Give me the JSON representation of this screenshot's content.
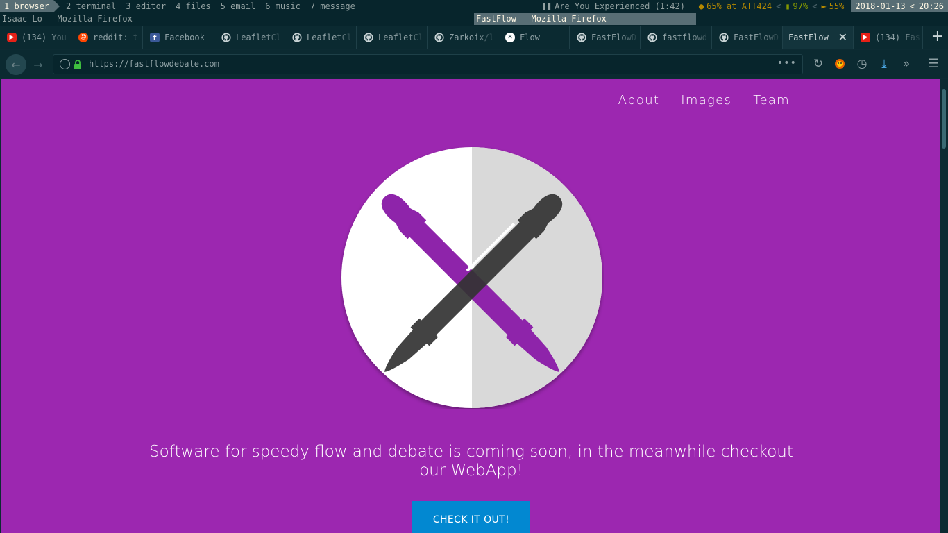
{
  "topbar": {
    "workspaces": [
      {
        "label": "1 browser",
        "active": true
      },
      {
        "label": "2 terminal",
        "active": false
      },
      {
        "label": "3 editor",
        "active": false
      },
      {
        "label": "4 files",
        "active": false
      },
      {
        "label": "5 email",
        "active": false
      },
      {
        "label": "6 music",
        "active": false
      },
      {
        "label": "7 message",
        "active": false
      }
    ],
    "music": "Are You Experienced (1:42)",
    "wifi": "65% at ATT424",
    "battery": "97%",
    "volume": "55%",
    "date": "2018-01-13",
    "time": "20:26"
  },
  "titles": {
    "left": "Isaac Lo - Mozilla Firefox",
    "focused": "FastFlow - Mozilla Firefox"
  },
  "tabs": [
    {
      "label": "(134) You",
      "icon": "youtube-icon"
    },
    {
      "label": "reddit: t",
      "icon": "reddit-icon"
    },
    {
      "label": "Facebook",
      "icon": "facebook-icon"
    },
    {
      "label": "LeafletCl",
      "icon": "github-icon"
    },
    {
      "label": "LeafletCl",
      "icon": "github-icon"
    },
    {
      "label": "LeafletCl",
      "icon": "github-icon"
    },
    {
      "label": "Zarkoix/l",
      "icon": "github-icon"
    },
    {
      "label": "Flow",
      "icon": "flow-icon"
    },
    {
      "label": "FastFlowD",
      "icon": "github-icon"
    },
    {
      "label": "fastflowd",
      "icon": "github-icon"
    },
    {
      "label": "FastFlowD",
      "icon": "github-icon"
    },
    {
      "label": "FastFlow",
      "icon": "none",
      "active": true
    },
    {
      "label": "(134) Eas",
      "icon": "youtube-icon"
    }
  ],
  "nav": {
    "url": "https://fastflowdebate.com",
    "more": "•••"
  },
  "page": {
    "nav_links": [
      "About",
      "Images",
      "Team"
    ],
    "tagline": "Software for speedy flow and debate is coming soon, in the meanwhile checkout our WebApp!",
    "cta": "CHECK IT OUT!",
    "background": "#9c27b0",
    "pen_purple": "#8e24aa",
    "pen_dark": "#333333",
    "button_color": "#0288d1"
  }
}
